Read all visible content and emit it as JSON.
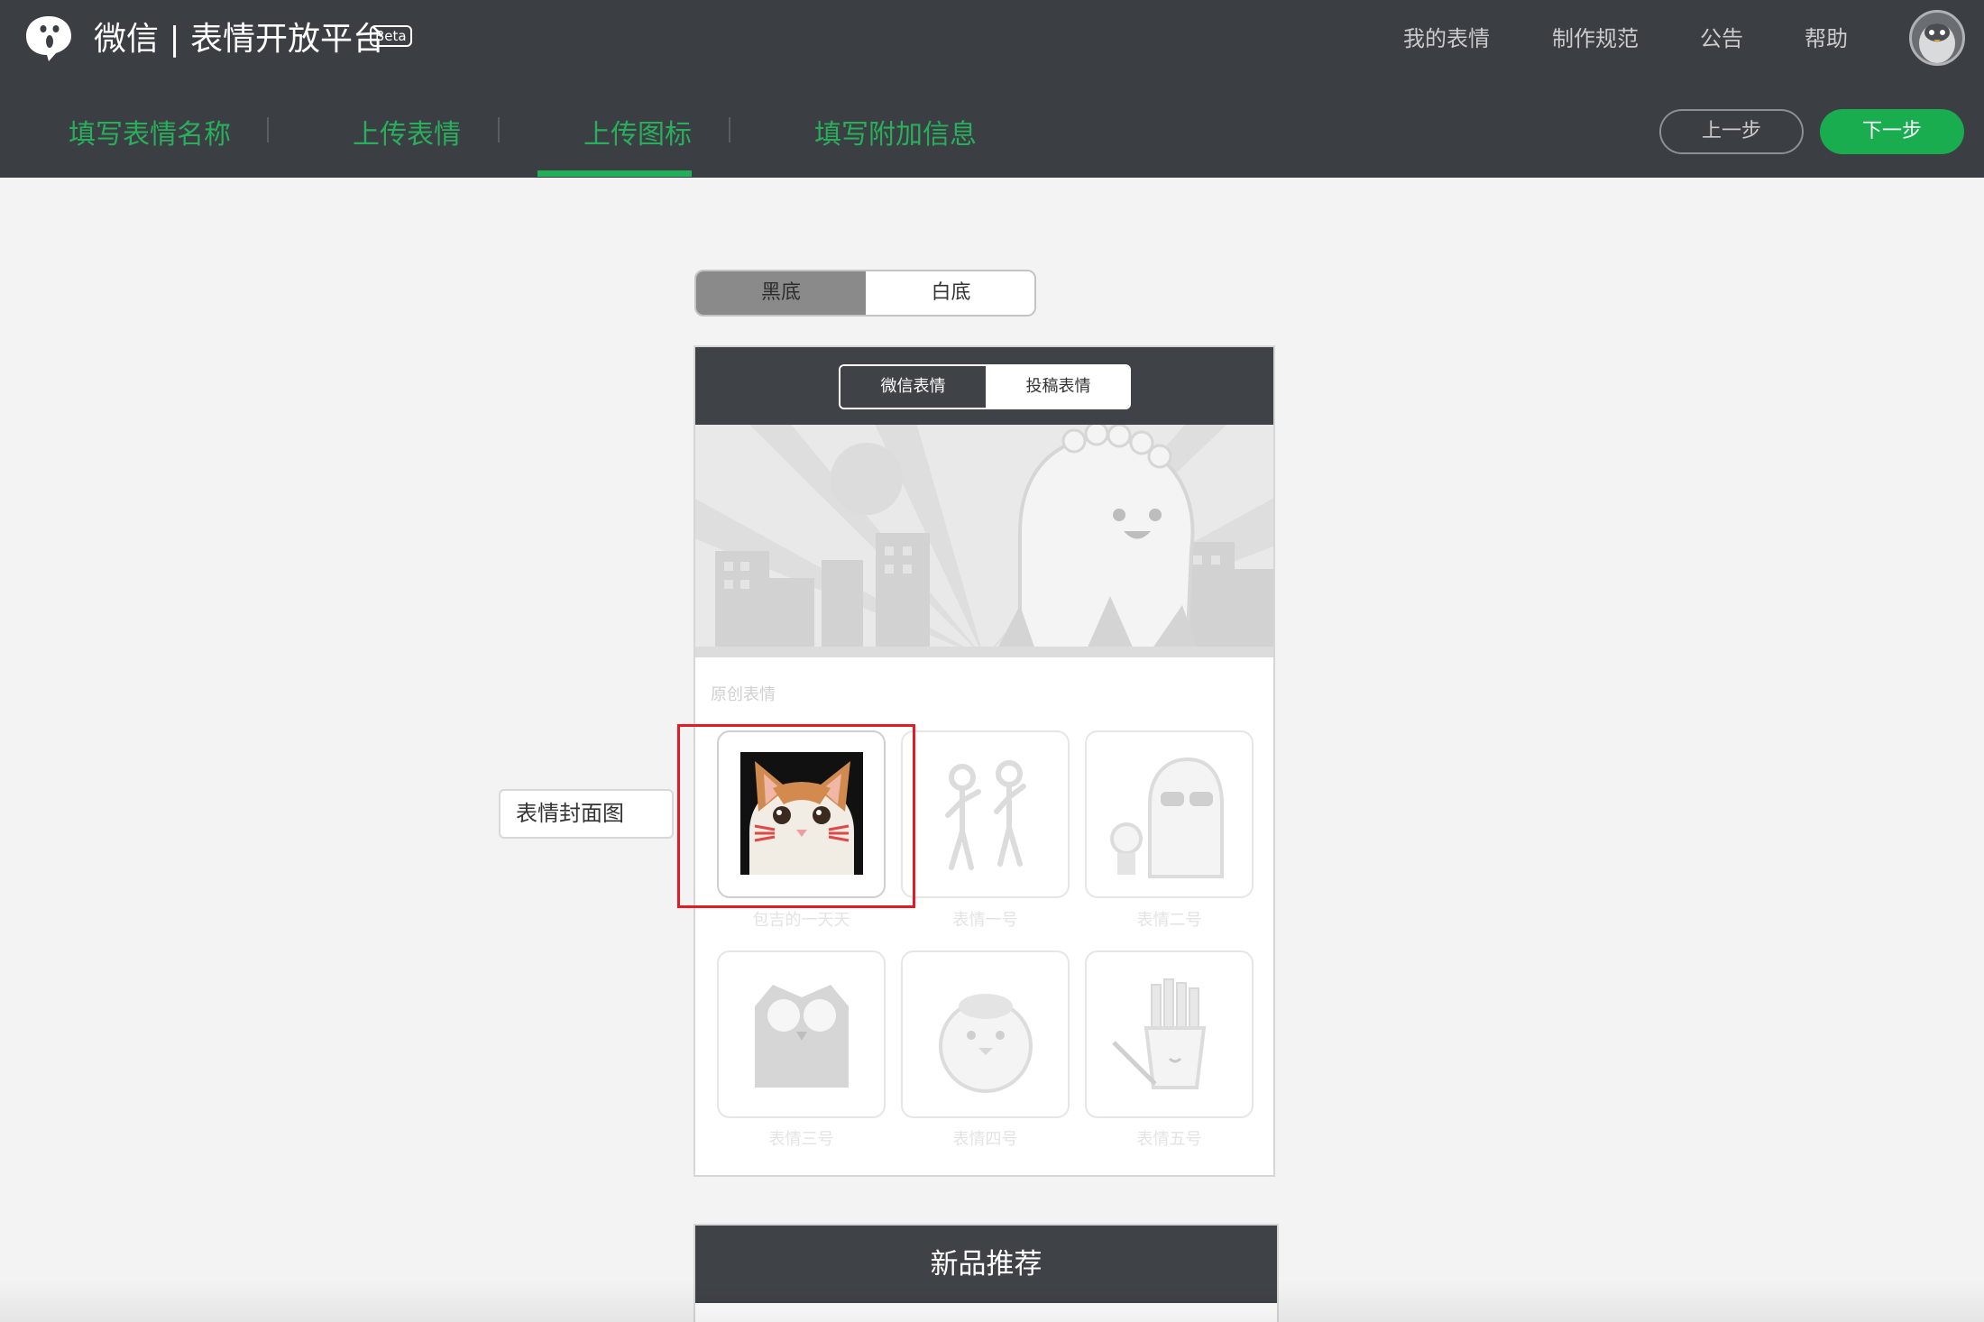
{
  "header": {
    "brand": "微信 | 表情开放平台",
    "beta": "Beta",
    "nav": [
      "我的表情",
      "制作规范",
      "公告",
      "帮助"
    ]
  },
  "steps": {
    "items": [
      "填写表情名称",
      "上传表情",
      "上传图标",
      "填写附加信息"
    ],
    "active_index": 2,
    "prev_label": "上一步",
    "next_label": "下一步"
  },
  "bg_toggle": {
    "options": [
      "黑底",
      "白底"
    ],
    "selected": "黑底"
  },
  "preview": {
    "tabs": [
      "微信表情",
      "投稿表情"
    ],
    "selected_tab": "微信表情",
    "section_label": "原创表情",
    "tiles": [
      {
        "name": "包吉的一天天",
        "icon": "cat-photo-icon",
        "highlighted": true
      },
      {
        "name": "表情一号",
        "icon": "dancing-figures-icon"
      },
      {
        "name": "表情二号",
        "icon": "sunglasses-dino-icon"
      },
      {
        "name": "表情三号",
        "icon": "owl-icon"
      },
      {
        "name": "表情四号",
        "icon": "chubby-bird-icon"
      },
      {
        "name": "表情五号",
        "icon": "fries-icon"
      }
    ]
  },
  "cover_label": "表情封面图",
  "new_section": {
    "title": "新品推荐"
  },
  "colors": {
    "header_bg": "#3b3e43",
    "accent_green": "#1aad50",
    "highlight_red": "#e31b23"
  }
}
